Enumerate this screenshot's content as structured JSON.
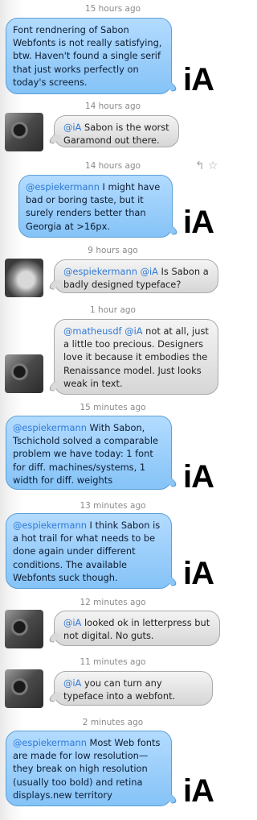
{
  "messages": [
    {
      "time": "15 hours ago",
      "mention": "",
      "mention2": "",
      "text": "Font rendnering of Sabon Webfonts is not really satisfying, btw. Haven't found a single serif that just works perfectly on today's screens."
    },
    {
      "time": "14 hours ago",
      "mention": "@iA",
      "mention2": "",
      "text": " Sabon is the worst Garamond out there."
    },
    {
      "time": "14 hours ago",
      "mention": "@espiekermann",
      "mention2": "",
      "text": " I might have bad or boring taste, but it surely renders better than Georgia at >16px."
    },
    {
      "time": "9 hours ago",
      "mention": "@espiekermann",
      "mention2": "@iA",
      "text": " Is Sabon a badly designed typeface?"
    },
    {
      "time": "1 hour ago",
      "mention": "@matheusdf",
      "mention2": "@iA",
      "text": " not at all, just a little too precious. Designers love it because it embodies the Renaissance model. Just looks weak in text."
    },
    {
      "time": "15 minutes ago",
      "mention": "@espiekermann",
      "mention2": "",
      "text": " With Sabon, Tschichold solved a comparable problem we have today: 1 font for diff. machines/systems, 1 width for diff. weights"
    },
    {
      "time": "13 minutes ago",
      "mention": "@espiekermann",
      "mention2": "",
      "text": " I think Sabon is a hot trail for what needs to be done again under different conditions. The available Webfonts suck though."
    },
    {
      "time": "12 minutes ago",
      "mention": "@iA",
      "mention2": "",
      "text": " looked ok in letterpress but not digital. No guts."
    },
    {
      "time": "11 minutes ago",
      "mention": "@iA",
      "mention2": "",
      "text": " you can turn any typeface into a webfont."
    },
    {
      "time": "2 minutes ago",
      "mention": "@espiekermann",
      "mention2": "",
      "text": " Most Web fonts are made for low resolution—they break on high resolution (usually too bold) and retina displays.new territory"
    }
  ],
  "brand": {
    "logo_text": "iA"
  },
  "icons": {
    "reply": "↰",
    "favorite": "☆"
  },
  "colors": {
    "blue_bubble": "#a3d2fb",
    "gray_bubble": "#e4e4e4",
    "mention": "#2f7ad6"
  }
}
